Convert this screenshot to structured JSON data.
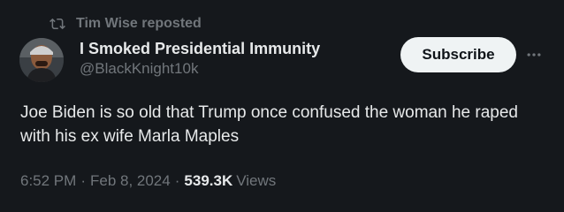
{
  "repost": {
    "label": "Tim Wise reposted",
    "icon": "repost-icon"
  },
  "author": {
    "display_name": "I Smoked Presidential Immunity",
    "handle": "@BlackKnight10k",
    "avatar_icon": "avatar"
  },
  "actions": {
    "subscribe_label": "Subscribe",
    "more_icon": "more-icon"
  },
  "tweet": {
    "text": "Joe Biden is so old that Trump once confused the woman he raped with his ex wife Marla Maples"
  },
  "meta": {
    "time": "6:52 PM",
    "date": "Feb 8, 2024",
    "separator": "·",
    "views_count": "539.3K",
    "views_label": "Views"
  },
  "colors": {
    "background": "#15181c",
    "text_primary": "#e7e9ea",
    "text_secondary": "#71767b",
    "button_bg": "#eff3f4",
    "button_text": "#0f1419"
  }
}
